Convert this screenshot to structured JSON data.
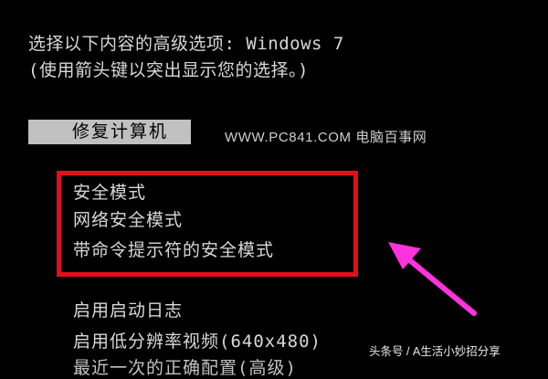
{
  "header": {
    "prompt_line": "选择以下内容的高级选项: Windows 7",
    "hint_line": "(使用箭头键以突出显示您的选择。)"
  },
  "menu": {
    "selected_item": "修复计算机",
    "safe_mode_group": [
      "安全模式",
      "网络安全模式",
      "带命令提示符的安全模式"
    ],
    "other_items": [
      "启用启动日志",
      "启用低分辨率视频(640x480)",
      "最近一次的正确配置(高级)"
    ]
  },
  "watermarks": {
    "site": "WWW.PC841.COM 电脑百事网",
    "bottom": "头条号 / A生活小妙招分享"
  },
  "colors": {
    "background": "#000000",
    "text": "#d8d8d8",
    "selection_bg": "#c0c0c0",
    "highlight_box": "#e0101a",
    "arrow": "#ff33dd"
  }
}
